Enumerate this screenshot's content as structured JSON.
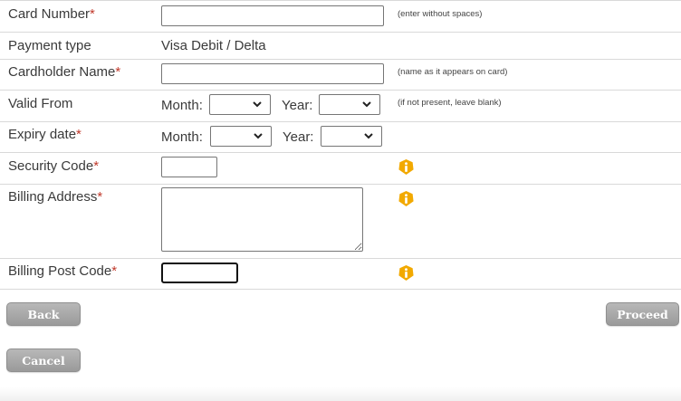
{
  "form": {
    "card_number": {
      "label": "Card Number",
      "required_mark": "*",
      "value": "",
      "hint": "(enter without spaces)"
    },
    "payment_type": {
      "label": "Payment type",
      "value": "Visa Debit / Delta"
    },
    "cardholder_name": {
      "label": "Cardholder Name",
      "required_mark": "*",
      "value": "",
      "hint": "(name as it appears on card)"
    },
    "valid_from": {
      "label": "Valid From",
      "month_label": "Month:",
      "year_label": "Year:",
      "month_value": "",
      "year_value": "",
      "hint": "(if not present, leave blank)"
    },
    "expiry_date": {
      "label": "Expiry date",
      "required_mark": "*",
      "month_label": "Month:",
      "year_label": "Year:",
      "month_value": "",
      "year_value": ""
    },
    "security_code": {
      "label": "Security Code",
      "required_mark": "*",
      "value": ""
    },
    "billing_address": {
      "label": "Billing Address",
      "required_mark": "*",
      "value": ""
    },
    "billing_post_code": {
      "label": "Billing Post Code",
      "required_mark": "*",
      "value": ""
    }
  },
  "icons": {
    "info": "info-icon",
    "dropdown": "chevron-down-icon"
  },
  "buttons": {
    "back": "Back",
    "proceed": "Proceed",
    "cancel": "Cancel"
  },
  "colors": {
    "required": "#c0392b",
    "info_icon": "#f2a900",
    "button": "#a8a8a8",
    "divider": "#d9d9d9"
  }
}
